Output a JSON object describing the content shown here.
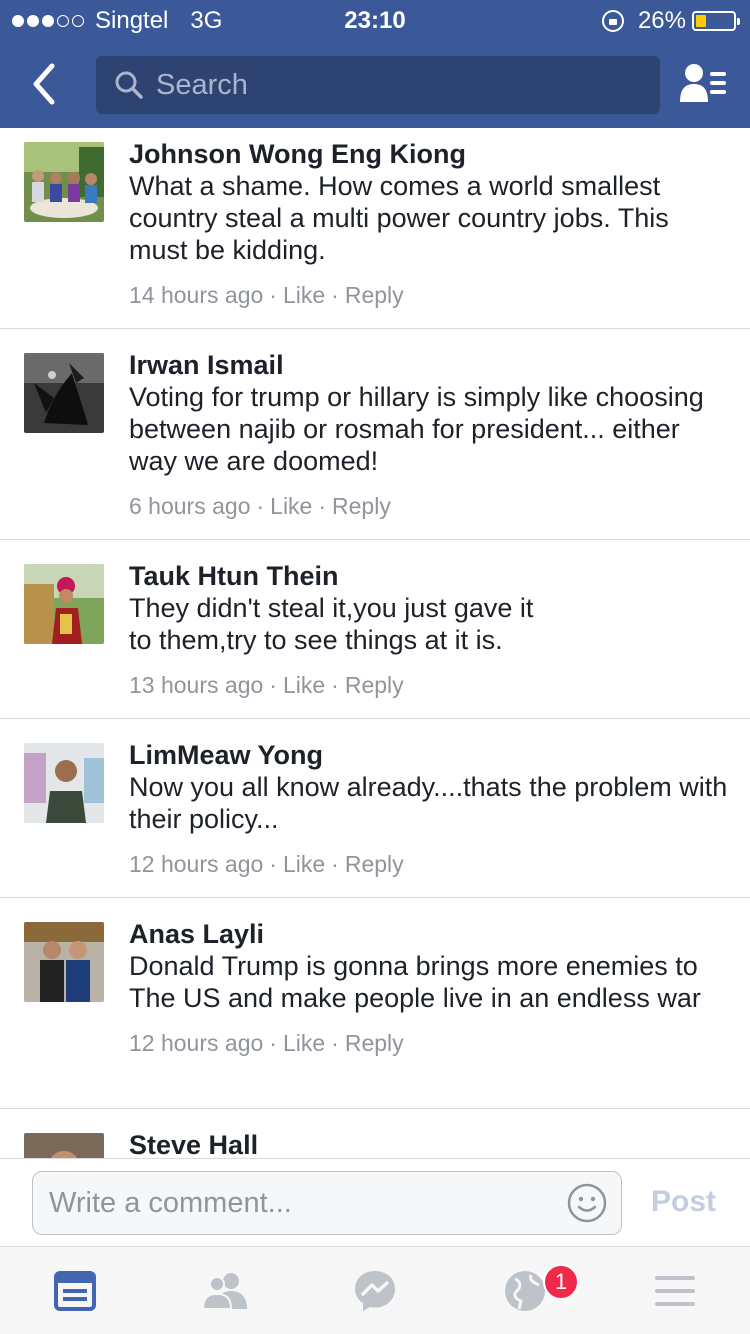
{
  "status_bar": {
    "carrier": "Singtel",
    "network": "3G",
    "time": "23:10",
    "battery_percent": "26%",
    "battery_level": 0.26,
    "signal_bars": 3,
    "signal_total": 5
  },
  "nav": {
    "search_placeholder": "Search",
    "back_icon": "chevron-left-icon",
    "friends_icon": "friend-list-icon"
  },
  "comments": [
    {
      "name": "Johnson Wong Eng Kiong",
      "text": "What a shame. How comes a world smallest country steal a multi power country jobs. This must be kidding.",
      "time": "14 hours ago",
      "like": "Like",
      "reply": "Reply"
    },
    {
      "name": "Irwan Ismail",
      "text": "Voting for trump or hillary is simply like choosing between najib or rosmah for president... either way we are doomed!",
      "time": "6 hours ago",
      "like": "Like",
      "reply": "Reply"
    },
    {
      "name": "Tauk Htun Thein",
      "text": "They didn't steal it,you just gave it to them,try to see things at it is.",
      "time": "13 hours ago",
      "like": "Like",
      "reply": "Reply"
    },
    {
      "name": "LimMeaw Yong",
      "text": "Now you all know already....thats the problem with their policy...",
      "time": "12 hours ago",
      "like": "Like",
      "reply": "Reply"
    },
    {
      "name": "Anas Layli",
      "text": "Donald Trump is gonna brings more enemies to The US and make people live in an endless war",
      "time": "12 hours ago",
      "like": "Like",
      "reply": "Reply"
    },
    {
      "name": "Steve Hall"
    }
  ],
  "composer": {
    "placeholder": "Write a comment...",
    "post_label": "Post"
  },
  "tabbar": {
    "tabs": [
      "news-feed-icon",
      "friends-icon",
      "messenger-icon",
      "notifications-globe-icon",
      "menu-icon"
    ],
    "notification_count": "1",
    "active_color": "#4267b2",
    "inactive_color": "#bec2c9"
  },
  "colors": {
    "brand": "#3b5998",
    "meta": "#90949c",
    "battery": "#ffcc00",
    "badge": "#f02849"
  }
}
